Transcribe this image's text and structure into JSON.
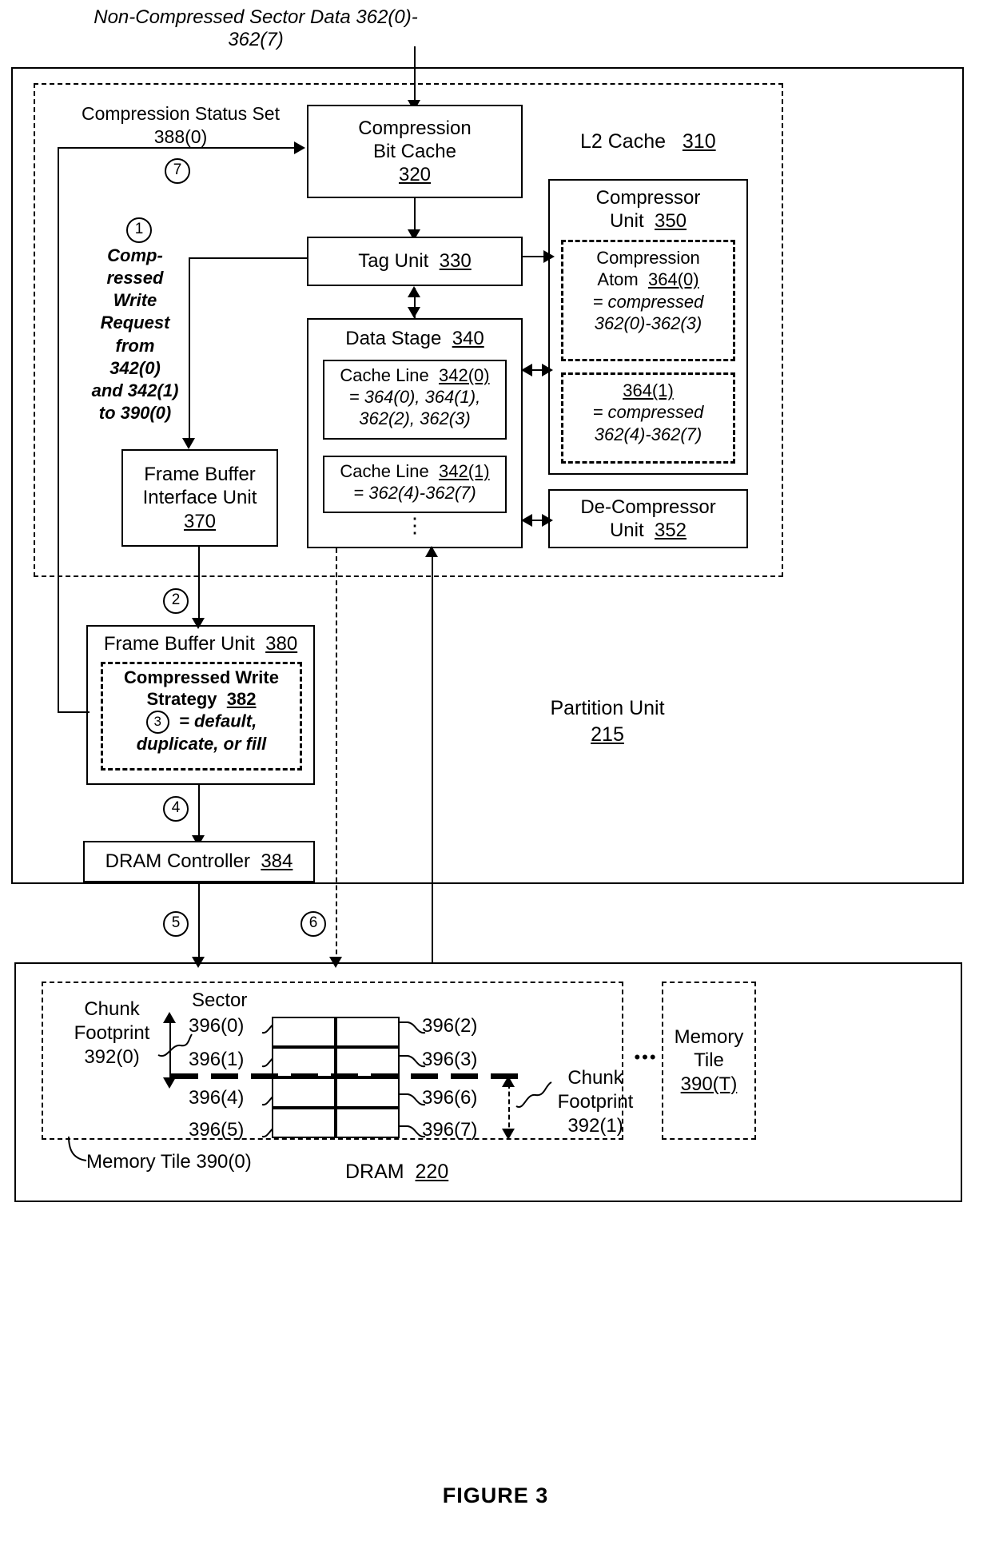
{
  "figure": {
    "caption": "FIGURE 3"
  },
  "top_label": {
    "line1": "Non-Compressed Sector Data 362(0)-",
    "line2": "362(7)"
  },
  "partition": {
    "label_line1": "Partition Unit",
    "label_line2": "215"
  },
  "l2cache": {
    "label": "L2 Cache",
    "ref": "310"
  },
  "compression_status": {
    "line1": "Compression Status Set",
    "line2": "388(0)",
    "step": "7"
  },
  "blocks": {
    "compression_bit_cache": {
      "line1": "Compression",
      "line2": "Bit Cache",
      "ref": "320"
    },
    "tag_unit": {
      "label": "Tag Unit",
      "ref": "330"
    },
    "data_stage": {
      "label": "Data Stage",
      "ref": "340"
    },
    "cache_line_0": {
      "label": "Cache Line",
      "ref": "342(0)",
      "line2": "= 364(0), 364(1),",
      "line3": "362(2), 362(3)"
    },
    "cache_line_1": {
      "label": "Cache Line",
      "ref": "342(1)",
      "line2": "= 362(4)-362(7)"
    },
    "ellipsis": "⋮",
    "compressor_unit": {
      "line1": "Compressor",
      "line2": "Unit",
      "ref": "350"
    },
    "compression_atom_0": {
      "line1": "Compression",
      "line2": "Atom",
      "ref": "364(0)",
      "line3": "= compressed",
      "line4": "362(0)-362(3)"
    },
    "compression_atom_1": {
      "ref": "364(1)",
      "line2": "= compressed",
      "line3": "362(4)-362(7)"
    },
    "decompressor_unit": {
      "line1": "De-Compressor",
      "line2": "Unit",
      "ref": "352"
    },
    "frame_buffer_interface_unit": {
      "line1": "Frame Buffer",
      "line2": "Interface Unit",
      "ref": "370"
    },
    "frame_buffer_unit": {
      "label": "Frame Buffer Unit",
      "ref": "380"
    },
    "compressed_write_strategy": {
      "line1": "Compressed Write",
      "line2": "Strategy",
      "ref": "382",
      "step": "3",
      "line3": "= default,",
      "line4": "duplicate, or fill"
    },
    "dram_controller": {
      "label": "DRAM Controller",
      "ref": "384"
    }
  },
  "steps": {
    "one": {
      "num": "1",
      "text_lines": [
        "Comp-",
        "ressed",
        "Write",
        "Request",
        "from",
        "342(0)",
        "and 342(1)",
        "to 390(0)"
      ]
    },
    "two": "2",
    "four": "4",
    "five": "5",
    "six": "6",
    "seven": "7"
  },
  "dram": {
    "label": "DRAM",
    "ref": "220",
    "memory_tile_0": "Memory Tile 390(0)",
    "memory_tile_t": {
      "line1": "Memory",
      "line2": "Tile",
      "ref": "390(T)"
    },
    "ellipsis": "•••",
    "sector_label": "Sector",
    "chunk_footprint_0": {
      "line1": "Chunk",
      "line2": "Footprint",
      "line3": "392(0)"
    },
    "chunk_footprint_1": {
      "line1": "Chunk",
      "line2": "Footprint",
      "line3": "392(1)"
    },
    "sectors_left": [
      "396(0)",
      "396(1)",
      "396(4)",
      "396(5)"
    ],
    "sectors_right": [
      "396(2)",
      "396(3)",
      "396(6)",
      "396(7)"
    ]
  },
  "colors": {
    "ink": "#000000",
    "paper": "#ffffff"
  }
}
